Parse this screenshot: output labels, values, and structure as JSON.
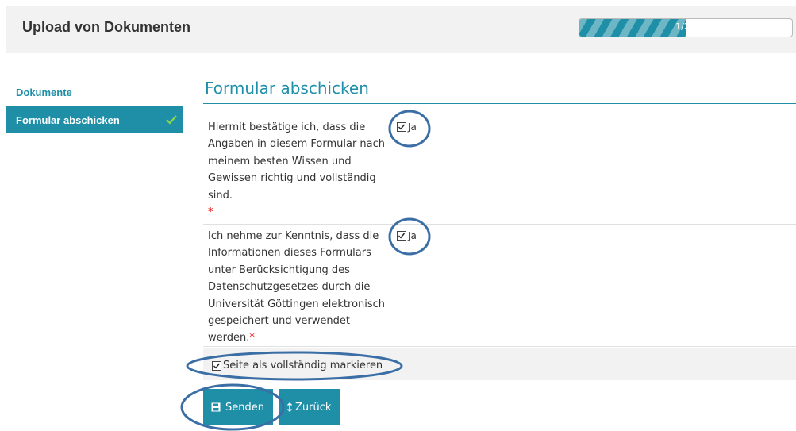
{
  "header": {
    "title": "Upload von Dokumenten"
  },
  "progress": {
    "text": "1/2",
    "fraction": 0.5
  },
  "sidebar": {
    "heading": "Dokumente",
    "items": [
      {
        "label": "Formular abschicken",
        "state": "complete"
      }
    ]
  },
  "main": {
    "title": "Formular abschicken",
    "questions": [
      {
        "text": "Hiermit bestätige ich, dass die Angaben in diesem Formular nach meinem besten Wissen und Gewissen richtig und vollständig sind.",
        "required_mark": "*",
        "option_label": "Ja",
        "checked": true
      },
      {
        "text": "Ich nehme zur Kenntnis, dass die Informationen dieses Formulars unter Berücksichtigung des Datenschutzgesetzes durch die Universität Göttingen elektronisch gespeichert und verwendet werden.",
        "required_mark": "*",
        "option_label": "Ja",
        "checked": true
      }
    ],
    "complete_checkbox": {
      "label": "Seite als vollständig markieren",
      "checked": true
    }
  },
  "buttons": {
    "send": "Senden",
    "back": "Zurück"
  },
  "colors": {
    "accent": "#1f8fa8",
    "required": "#e00000",
    "annotation": "#3a6ea5"
  },
  "icons": [
    "check-icon",
    "checkbox-checked-icon",
    "save-icon",
    "back-arrow-icon"
  ]
}
